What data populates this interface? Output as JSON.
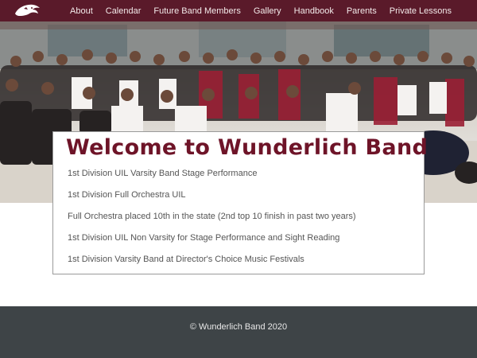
{
  "nav": {
    "items": [
      "About",
      "Calendar",
      "Future Band Members",
      "Gallery",
      "Handbook",
      "Parents",
      "Private Lessons"
    ]
  },
  "hero": {
    "title": "Welcome to Wunderlich Band",
    "achievements": [
      "1st Division UIL Varsity Band Stage Performance",
      "1st Division Full Orchestra UIL",
      "Full Orchestra placed 10th in the state (2nd top 10 finish in past two years)",
      "1st Division UIL Non Varsity for Stage Performance and Sight Reading",
      "1st Division Varsity Band at Director's Choice Music Festivals"
    ]
  },
  "footer": {
    "copyright": "© Wunderlich Band 2020"
  },
  "colors": {
    "navbar": "#5a1a2a",
    "title": "#6e1428",
    "footer": "#3e4447"
  },
  "icons": {
    "logo": "cougar-logo-icon"
  }
}
